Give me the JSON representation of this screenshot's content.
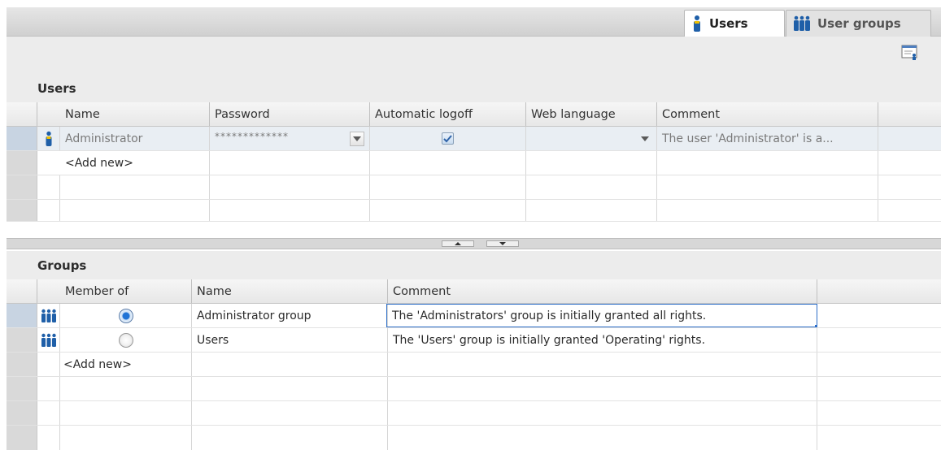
{
  "tabs": [
    {
      "label": "Users",
      "icon": "user-icon",
      "active": true
    },
    {
      "label": "User groups",
      "icon": "user-group-icon",
      "active": false
    }
  ],
  "toolbar": {
    "icon": "user-settings-icon"
  },
  "users_section": {
    "title": "Users",
    "columns": [
      "Name",
      "Password",
      "Automatic logoff",
      "Web language",
      "Comment"
    ],
    "rows": [
      {
        "name": "Administrator",
        "password": "*************",
        "automatic_logoff": true,
        "web_language": "",
        "comment": "The user 'Administrator' is a..."
      }
    ],
    "add_new": "<Add new>"
  },
  "groups_section": {
    "title": "Groups",
    "columns": [
      "Member of",
      "Name",
      "Comment"
    ],
    "rows": [
      {
        "member_of": true,
        "name": "Administrator group",
        "comment": "The 'Administrators' group is initially granted all rights."
      },
      {
        "member_of": false,
        "name": "Users",
        "comment": "The 'Users' group is initially granted 'Operating' rights."
      }
    ],
    "add_new": "<Add new>"
  },
  "colors": {
    "selection": "#c8d4e2",
    "focus_border": "#2e6fc9",
    "icon_blue": "#1f5fa8"
  }
}
